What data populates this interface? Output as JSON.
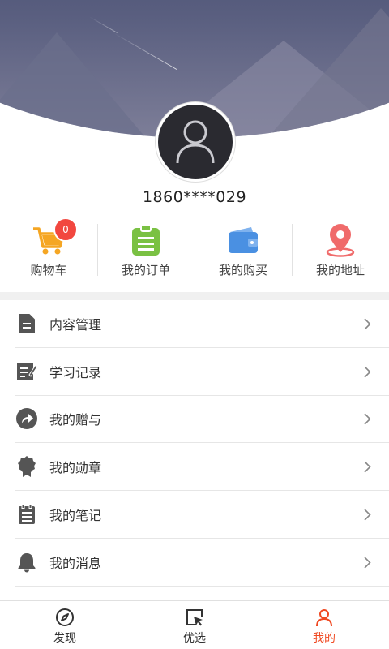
{
  "profile": {
    "phone": "1860****029"
  },
  "actions": [
    {
      "label": "购物车",
      "icon": "cart-icon",
      "badge": "0"
    },
    {
      "label": "我的订单",
      "icon": "clipboard-icon"
    },
    {
      "label": "我的购买",
      "icon": "wallet-icon"
    },
    {
      "label": "我的地址",
      "icon": "location-pin-icon"
    }
  ],
  "menu": [
    {
      "label": "内容管理",
      "icon": "document-icon"
    },
    {
      "label": "学习记录",
      "icon": "edit-note-icon"
    },
    {
      "label": "我的赠与",
      "icon": "share-arrow-icon"
    },
    {
      "label": "我的勋章",
      "icon": "medal-icon"
    },
    {
      "label": "我的笔记",
      "icon": "notepad-icon"
    },
    {
      "label": "我的消息",
      "icon": "bell-icon"
    }
  ],
  "tabs": [
    {
      "label": "发现",
      "icon": "compass-icon",
      "active": false
    },
    {
      "label": "优选",
      "icon": "cursor-select-icon",
      "active": false
    },
    {
      "label": "我的",
      "icon": "person-icon",
      "active": true
    }
  ],
  "colors": {
    "accent": "#f04a23",
    "badge": "#f2473f",
    "cart": "#f5a623",
    "order": "#7ac143",
    "wallet": "#4a90e2",
    "pin": "#f06b6b"
  }
}
